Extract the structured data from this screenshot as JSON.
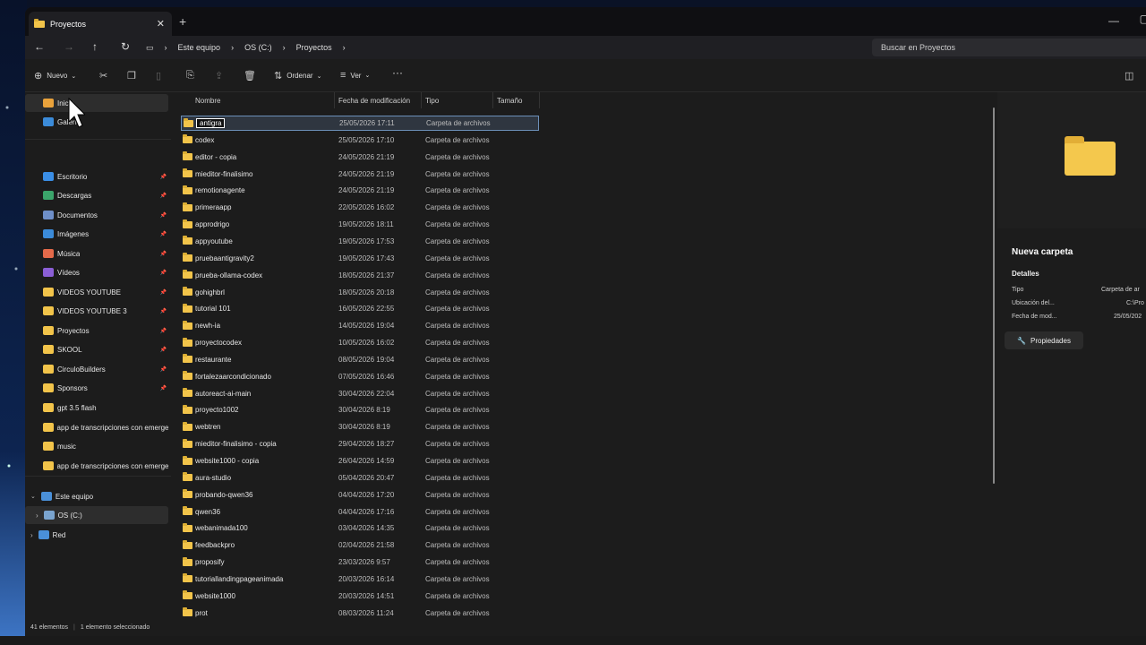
{
  "window": {
    "tab_title": "Proyectos",
    "close": "✕",
    "new_tab": "+"
  },
  "nav": {
    "back": "←",
    "forward": "→",
    "up": "↑",
    "refresh": "↻",
    "breadcrumb": [
      "Este equipo",
      "OS (C:)",
      "Proyectos"
    ],
    "sep": "›",
    "search_placeholder": "Buscar en Proyectos"
  },
  "toolbar": {
    "new_label": "Nuevo",
    "sort_label": "Ordenar",
    "view_label": "Ver",
    "more": "···"
  },
  "sidebar": {
    "home": "Inicio",
    "gallery": "Galería",
    "pinned": [
      {
        "label": "Escritorio",
        "color": "#3a8ee6"
      },
      {
        "label": "Descargas",
        "color": "#3ba56b"
      },
      {
        "label": "Documentos",
        "color": "#6e8fc9"
      },
      {
        "label": "Imágenes",
        "color": "#3b8bd9"
      },
      {
        "label": "Música",
        "color": "#e46a4a"
      },
      {
        "label": "Vídeos",
        "color": "#8b5fd6"
      },
      {
        "label": "VIDEOS YOUTUBE",
        "color": "#f2c44a"
      },
      {
        "label": "VIDEOS YOUTUBE 3",
        "color": "#f2c44a"
      },
      {
        "label": "Proyectos",
        "color": "#f2c44a"
      },
      {
        "label": "SKOOL",
        "color": "#f2c44a"
      },
      {
        "label": "CirculoBuilders",
        "color": "#f2c44a"
      },
      {
        "label": "Sponsors",
        "color": "#f2c44a"
      },
      {
        "label": "gpt 3.5 flash",
        "color": "#f2c44a"
      },
      {
        "label": "app de transcripciones con emergen",
        "color": "#f2c44a"
      },
      {
        "label": "music",
        "color": "#f2c44a"
      },
      {
        "label": "app de transcripciones con emergen",
        "color": "#f2c44a"
      }
    ],
    "this_pc": "Este equipo",
    "drive": "OS (C:)",
    "network": "Red"
  },
  "columns": {
    "name": "Nombre",
    "date": "Fecha de modificación",
    "type": "Tipo",
    "size": "Tamaño"
  },
  "files": [
    {
      "name": "antigra",
      "date": "25/05/2026 17:11",
      "type": "Carpeta de archivos"
    },
    {
      "name": "codex",
      "date": "25/05/2026 17:10",
      "type": "Carpeta de archivos"
    },
    {
      "name": "editor - copia",
      "date": "24/05/2026 21:19",
      "type": "Carpeta de archivos"
    },
    {
      "name": "mieditor-finalisimo",
      "date": "24/05/2026 21:19",
      "type": "Carpeta de archivos"
    },
    {
      "name": "remotionagente",
      "date": "24/05/2026 21:19",
      "type": "Carpeta de archivos"
    },
    {
      "name": "primeraapp",
      "date": "22/05/2026 16:02",
      "type": "Carpeta de archivos"
    },
    {
      "name": "approdrigo",
      "date": "19/05/2026 18:11",
      "type": "Carpeta de archivos"
    },
    {
      "name": "appyoutube",
      "date": "19/05/2026 17:53",
      "type": "Carpeta de archivos"
    },
    {
      "name": "pruebaantigravity2",
      "date": "19/05/2026 17:43",
      "type": "Carpeta de archivos"
    },
    {
      "name": "prueba-ollama-codex",
      "date": "18/05/2026 21:37",
      "type": "Carpeta de archivos"
    },
    {
      "name": "gohighbrl",
      "date": "18/05/2026 20:18",
      "type": "Carpeta de archivos"
    },
    {
      "name": "tutorial 101",
      "date": "16/05/2026 22:55",
      "type": "Carpeta de archivos"
    },
    {
      "name": "newh-ia",
      "date": "14/05/2026 19:04",
      "type": "Carpeta de archivos"
    },
    {
      "name": "proyectocodex",
      "date": "10/05/2026 16:02",
      "type": "Carpeta de archivos"
    },
    {
      "name": "restaurante",
      "date": "08/05/2026 19:04",
      "type": "Carpeta de archivos"
    },
    {
      "name": "fortalezaarcondicionado",
      "date": "07/05/2026 16:46",
      "type": "Carpeta de archivos"
    },
    {
      "name": "autoreact-ai-main",
      "date": "30/04/2026 22:04",
      "type": "Carpeta de archivos"
    },
    {
      "name": "proyecto1002",
      "date": "30/04/2026 8:19",
      "type": "Carpeta de archivos"
    },
    {
      "name": "webtren",
      "date": "30/04/2026 8:19",
      "type": "Carpeta de archivos"
    },
    {
      "name": "mieditor-finalisimo - copia",
      "date": "29/04/2026 18:27",
      "type": "Carpeta de archivos"
    },
    {
      "name": "website1000 - copia",
      "date": "26/04/2026 14:59",
      "type": "Carpeta de archivos"
    },
    {
      "name": "aura-studio",
      "date": "05/04/2026 20:47",
      "type": "Carpeta de archivos"
    },
    {
      "name": "probando-qwen36",
      "date": "04/04/2026 17:20",
      "type": "Carpeta de archivos"
    },
    {
      "name": "qwen36",
      "date": "04/04/2026 17:16",
      "type": "Carpeta de archivos"
    },
    {
      "name": "webanimada100",
      "date": "03/04/2026 14:35",
      "type": "Carpeta de archivos"
    },
    {
      "name": "feedbackpro",
      "date": "02/04/2026 21:58",
      "type": "Carpeta de archivos"
    },
    {
      "name": "proposify",
      "date": "23/03/2026 9:57",
      "type": "Carpeta de archivos"
    },
    {
      "name": "tutoriallandingpageanimada",
      "date": "20/03/2026 16:14",
      "type": "Carpeta de archivos"
    },
    {
      "name": "website1000",
      "date": "20/03/2026 14:51",
      "type": "Carpeta de archivos"
    },
    {
      "name": "prot",
      "date": "08/03/2026 11:24",
      "type": "Carpeta de archivos"
    }
  ],
  "details": {
    "title": "Nueva carpeta",
    "section": "Detalles",
    "rows": [
      {
        "k": "Tipo",
        "v": "Carpeta de ar"
      },
      {
        "k": "Ubicación del...",
        "v": "C:\\Pro"
      },
      {
        "k": "Fecha de mod...",
        "v": "25/05/202"
      }
    ],
    "properties": "Propiedades"
  },
  "status": {
    "count": "41 elementos",
    "selected": "1 elemento seleccionado"
  }
}
